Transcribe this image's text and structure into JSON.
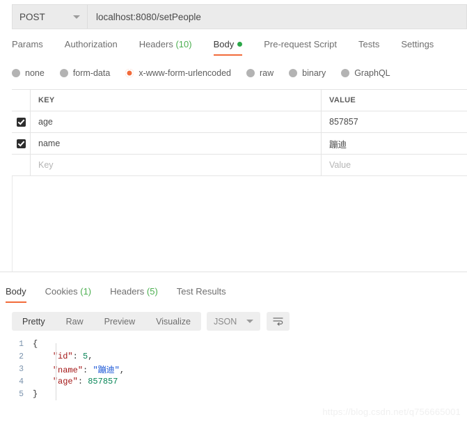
{
  "request": {
    "method": "POST",
    "url": "localhost:8080/setPeople",
    "tabs": [
      {
        "label": "Params",
        "count": "",
        "active": false,
        "dot": false
      },
      {
        "label": "Authorization",
        "count": "",
        "active": false,
        "dot": false
      },
      {
        "label": "Headers",
        "count": "(10)",
        "active": false,
        "dot": false
      },
      {
        "label": "Body",
        "count": "",
        "active": true,
        "dot": true
      },
      {
        "label": "Pre-request Script",
        "count": "",
        "active": false,
        "dot": false
      },
      {
        "label": "Tests",
        "count": "",
        "active": false,
        "dot": false
      },
      {
        "label": "Settings",
        "count": "",
        "active": false,
        "dot": false
      }
    ],
    "body_types": [
      {
        "label": "none",
        "checked": false
      },
      {
        "label": "form-data",
        "checked": false
      },
      {
        "label": "x-www-form-urlencoded",
        "checked": true
      },
      {
        "label": "raw",
        "checked": false
      },
      {
        "label": "binary",
        "checked": false
      },
      {
        "label": "GraphQL",
        "checked": false
      }
    ],
    "table": {
      "headers": {
        "key": "KEY",
        "value": "VALUE"
      },
      "rows": [
        {
          "checked": true,
          "key": "age",
          "value": "857857"
        },
        {
          "checked": true,
          "key": "name",
          "value": "蹦迪"
        }
      ],
      "placeholder_row": {
        "key": "Key",
        "value": "Value"
      }
    }
  },
  "response": {
    "tabs": [
      {
        "label": "Body",
        "count": "",
        "active": true
      },
      {
        "label": "Cookies",
        "count": "(1)",
        "active": false
      },
      {
        "label": "Headers",
        "count": "(5)",
        "active": false
      },
      {
        "label": "Test Results",
        "count": "",
        "active": false
      }
    ],
    "view_modes": [
      {
        "label": "Pretty",
        "active": true
      },
      {
        "label": "Raw",
        "active": false
      },
      {
        "label": "Preview",
        "active": false
      },
      {
        "label": "Visualize",
        "active": false
      }
    ],
    "format": "JSON",
    "wrap_icon": "wrap-text-icon",
    "body_lines": [
      {
        "n": "1",
        "indent": 0,
        "parts": [
          {
            "t": "{",
            "c": "j-punct"
          }
        ]
      },
      {
        "n": "2",
        "indent": 1,
        "parts": [
          {
            "t": "\"id\"",
            "c": "j-key"
          },
          {
            "t": ": ",
            "c": "j-punct"
          },
          {
            "t": "5",
            "c": "j-num"
          },
          {
            "t": ",",
            "c": "j-punct"
          }
        ]
      },
      {
        "n": "3",
        "indent": 1,
        "parts": [
          {
            "t": "\"name\"",
            "c": "j-key"
          },
          {
            "t": ": ",
            "c": "j-punct"
          },
          {
            "t": "\"蹦迪\"",
            "c": "j-str"
          },
          {
            "t": ",",
            "c": "j-punct"
          }
        ]
      },
      {
        "n": "4",
        "indent": 1,
        "parts": [
          {
            "t": "\"age\"",
            "c": "j-key"
          },
          {
            "t": ": ",
            "c": "j-punct"
          },
          {
            "t": "857857",
            "c": "j-num"
          }
        ]
      },
      {
        "n": "5",
        "indent": 0,
        "parts": [
          {
            "t": "}",
            "c": "j-punct"
          }
        ]
      }
    ]
  },
  "watermark": "https://blog.csdn.net/q756665001",
  "colors": {
    "accent": "#f26b3a",
    "green": "#4caf50",
    "status_dot": "#2aa748"
  }
}
